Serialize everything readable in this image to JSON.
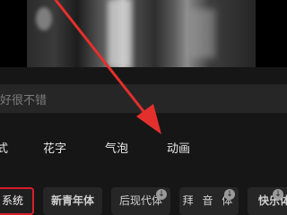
{
  "input": {
    "text": "好很不错"
  },
  "tabs": [
    {
      "label": "式"
    },
    {
      "label": "花字"
    },
    {
      "label": "气泡"
    },
    {
      "label": "动画"
    }
  ],
  "font_chips": [
    {
      "label": "系统",
      "selected": true
    },
    {
      "label": "新青年体",
      "selected": false
    },
    {
      "label": "后现代体",
      "selected": false,
      "download_icon": "download-icon"
    },
    {
      "label": "拜 音 体",
      "selected": false,
      "download_icon": "download-icon"
    },
    {
      "label": "快乐体",
      "selected": false,
      "download_icon": "download-icon"
    }
  ],
  "colors": {
    "accent": "#d81e2c",
    "background": "#161616",
    "chip_bg": "#262626",
    "annotation_arrow": "#e4302c"
  }
}
